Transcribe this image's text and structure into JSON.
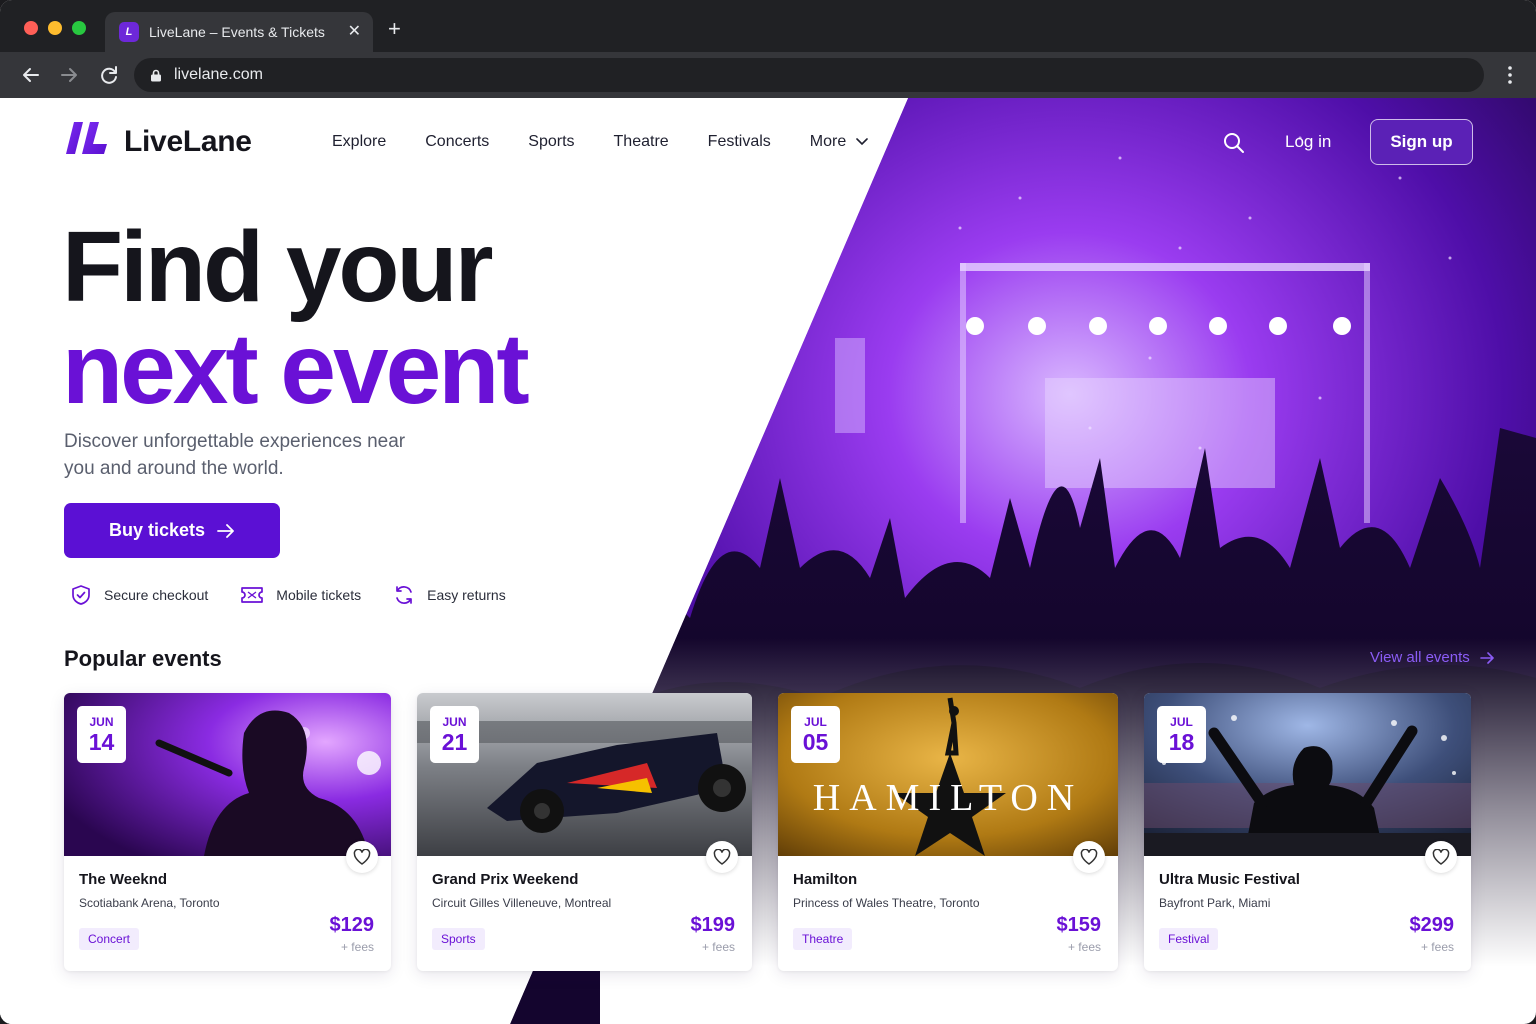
{
  "browser": {
    "tab_title": "LiveLane – Events & Tickets",
    "favicon_text": "L",
    "url": "livelane.com"
  },
  "brand": {
    "name": "LiveLane",
    "accent": "#6a11d6"
  },
  "nav": {
    "items": [
      "Explore",
      "Concerts",
      "Sports",
      "Theatre",
      "Festivals",
      "More"
    ],
    "login": "Log in",
    "signup": "Sign up"
  },
  "hero": {
    "line1": "Find your",
    "line2": "next event",
    "subtitle": "Discover unforgettable experiences near you and around the world.",
    "cta": "Buy tickets"
  },
  "features": [
    "Secure checkout",
    "Mobile tickets",
    "Easy returns"
  ],
  "popular": {
    "title": "Popular events",
    "view_all": "View all events",
    "events": [
      {
        "month": "JUN",
        "day": "14",
        "title": "The Weeknd",
        "venue": "Scotiabank Arena, Toronto",
        "category": "Concert",
        "price": "$129",
        "fees": "+ fees"
      },
      {
        "month": "JUN",
        "day": "21",
        "title": "Grand Prix Weekend",
        "venue": "Circuit Gilles Villeneuve, Montreal",
        "category": "Sports",
        "price": "$199",
        "fees": "+ fees"
      },
      {
        "month": "JUL",
        "day": "05",
        "title": "Hamilton",
        "venue": "Princess of Wales Theatre, Toronto",
        "category": "Theatre",
        "price": "$159",
        "fees": "+ fees",
        "image_text": "HAMILTON"
      },
      {
        "month": "JUL",
        "day": "18",
        "title": "Ultra Music Festival",
        "venue": "Bayfront Park, Miami",
        "category": "Festival",
        "price": "$299",
        "fees": "+ fees"
      }
    ]
  }
}
